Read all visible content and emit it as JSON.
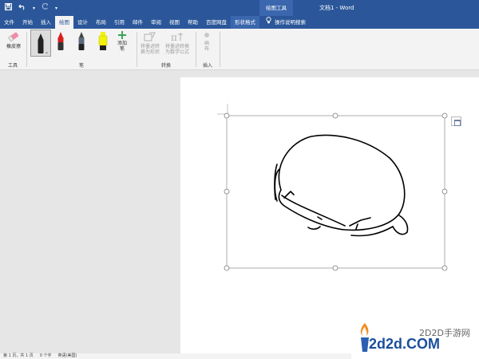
{
  "titlebar": {
    "contextual_header": "绘图工具",
    "doc_title": "文档1 - Word"
  },
  "tabs": [
    {
      "label": "文件"
    },
    {
      "label": "开始"
    },
    {
      "label": "插入"
    },
    {
      "label": "绘图"
    },
    {
      "label": "设计"
    },
    {
      "label": "布局"
    },
    {
      "label": "引用"
    },
    {
      "label": "邮件"
    },
    {
      "label": "审阅"
    },
    {
      "label": "视图"
    },
    {
      "label": "帮助"
    },
    {
      "label": "百度网盘"
    },
    {
      "label": "形状格式"
    }
  ],
  "tell_me": "操作说明搜索",
  "ribbon": {
    "tools_group": {
      "label": "工具",
      "eraser": "橡皮擦"
    },
    "pens_group": {
      "label": "笔",
      "add_pen_line1": "添加",
      "add_pen_line2": "笔"
    },
    "convert_group": {
      "label": "转换",
      "ink_to_shape_line1": "将墨迹转",
      "ink_to_shape_line2": "换为形状",
      "ink_to_math_line1": "将墨迹转换",
      "ink_to_math_line2": "为数学公式"
    },
    "insert_group": {
      "label": "插入",
      "canvas_line1": "画",
      "canvas_line2": "布"
    }
  },
  "statusbar": {
    "page": "第 1 页，共 1 页",
    "words": "0 个字",
    "language": "英语(美国)"
  },
  "watermark": {
    "cn": "2D2D手游网",
    "en": "2d2d.COM"
  },
  "colors": {
    "word_blue": "#2b579a",
    "contextual_tab": "#3a67ad",
    "pen_black": "#222222",
    "pen_red": "#d81e1e",
    "highlighter_yellow": "#f2f20a",
    "add_pen_green": "#3aa35a"
  },
  "icons": [
    "save-icon",
    "undo-icon",
    "redo-icon",
    "lightbulb-icon",
    "eraser-icon",
    "pen-icon",
    "highlighter-icon",
    "plus-icon",
    "ink-to-shape-icon",
    "ink-to-math-icon",
    "canvas-icon",
    "layout-options-icon"
  ]
}
